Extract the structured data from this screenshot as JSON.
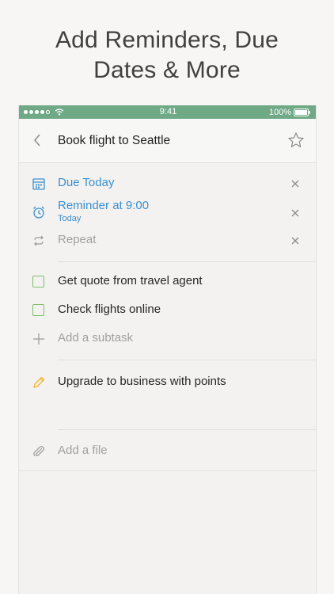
{
  "headline": {
    "line1": "Add Reminders, Due",
    "line2": "Dates & More"
  },
  "status_bar": {
    "time": "9:41",
    "battery": "100%"
  },
  "task": {
    "title": "Book flight to Seattle"
  },
  "details": {
    "due": "Due Today",
    "reminder": "Reminder at 9:00",
    "reminder_sub": "Today",
    "repeat": "Repeat"
  },
  "subtasks": [
    {
      "label": "Get quote from travel agent"
    },
    {
      "label": "Check flights online"
    }
  ],
  "add_subtask_placeholder": "Add a subtask",
  "note": "Upgrade to business with points",
  "add_file_label": "Add a file",
  "colors": {
    "accent_green": "#6fa986",
    "link_blue": "#3a8fd1",
    "checkbox_green": "#7cbf6a",
    "pencil_orange": "#f0b429"
  },
  "icons": {
    "back": "chevron-left-icon",
    "star": "star-icon",
    "due": "calendar-icon",
    "reminder": "alarm-clock-icon",
    "repeat": "repeat-icon",
    "clear": "close-icon",
    "add": "plus-icon",
    "note": "pencil-icon",
    "file": "paperclip-icon"
  }
}
